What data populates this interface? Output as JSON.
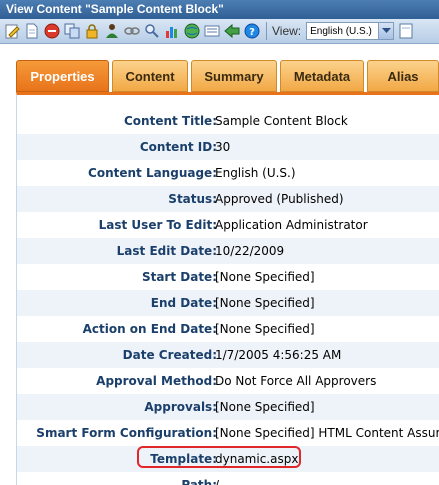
{
  "window": {
    "title": "View Content \"Sample Content Block\""
  },
  "toolbar": {
    "icons": [
      "edit-icon",
      "page-icon",
      "delete-icon",
      "copy-icon",
      "lock-icon",
      "users-icon",
      "link-icon",
      "search-icon",
      "chart-icon",
      "globe-icon",
      "properties-icon",
      "back-arrow-icon",
      "help-icon"
    ],
    "view_label": "View:",
    "language": "English (U.S.)"
  },
  "tabs": [
    {
      "label": "Properties",
      "active": true
    },
    {
      "label": "Content",
      "active": false
    },
    {
      "label": "Summary",
      "active": false
    },
    {
      "label": "Metadata",
      "active": false
    },
    {
      "label": "Alias",
      "active": false
    }
  ],
  "properties": [
    {
      "label": "Content Title:",
      "value": "Sample Content Block"
    },
    {
      "label": "Content ID:",
      "value": "30"
    },
    {
      "label": "Content Language:",
      "value": "English (U.S.)"
    },
    {
      "label": "Status:",
      "value": "Approved (Published)"
    },
    {
      "label": "Last User To Edit:",
      "value": "Application Administrator"
    },
    {
      "label": "Last Edit Date:",
      "value": "10/22/2009"
    },
    {
      "label": "Start Date:",
      "value": "[None Specified]"
    },
    {
      "label": "End Date:",
      "value": "[None Specified]"
    },
    {
      "label": "Action on End Date:",
      "value": "[None Specified]"
    },
    {
      "label": "Date Created:",
      "value": "1/7/2005 4:56:25 AM"
    },
    {
      "label": "Approval Method:",
      "value": "Do Not Force All Approvers"
    },
    {
      "label": "Approvals:",
      "value": "[None Specified]"
    },
    {
      "label": "Smart Form Configuration:",
      "value": "[None Specified] HTML Content Assum"
    },
    {
      "label": "Template:",
      "value": "dynamic.aspx"
    },
    {
      "label": "Path:",
      "value": "/"
    }
  ],
  "colors": {
    "highlight": "#e0282b",
    "active_tab": "#e8731a",
    "tab": "#f2a845",
    "label": "#1b3f6b"
  }
}
